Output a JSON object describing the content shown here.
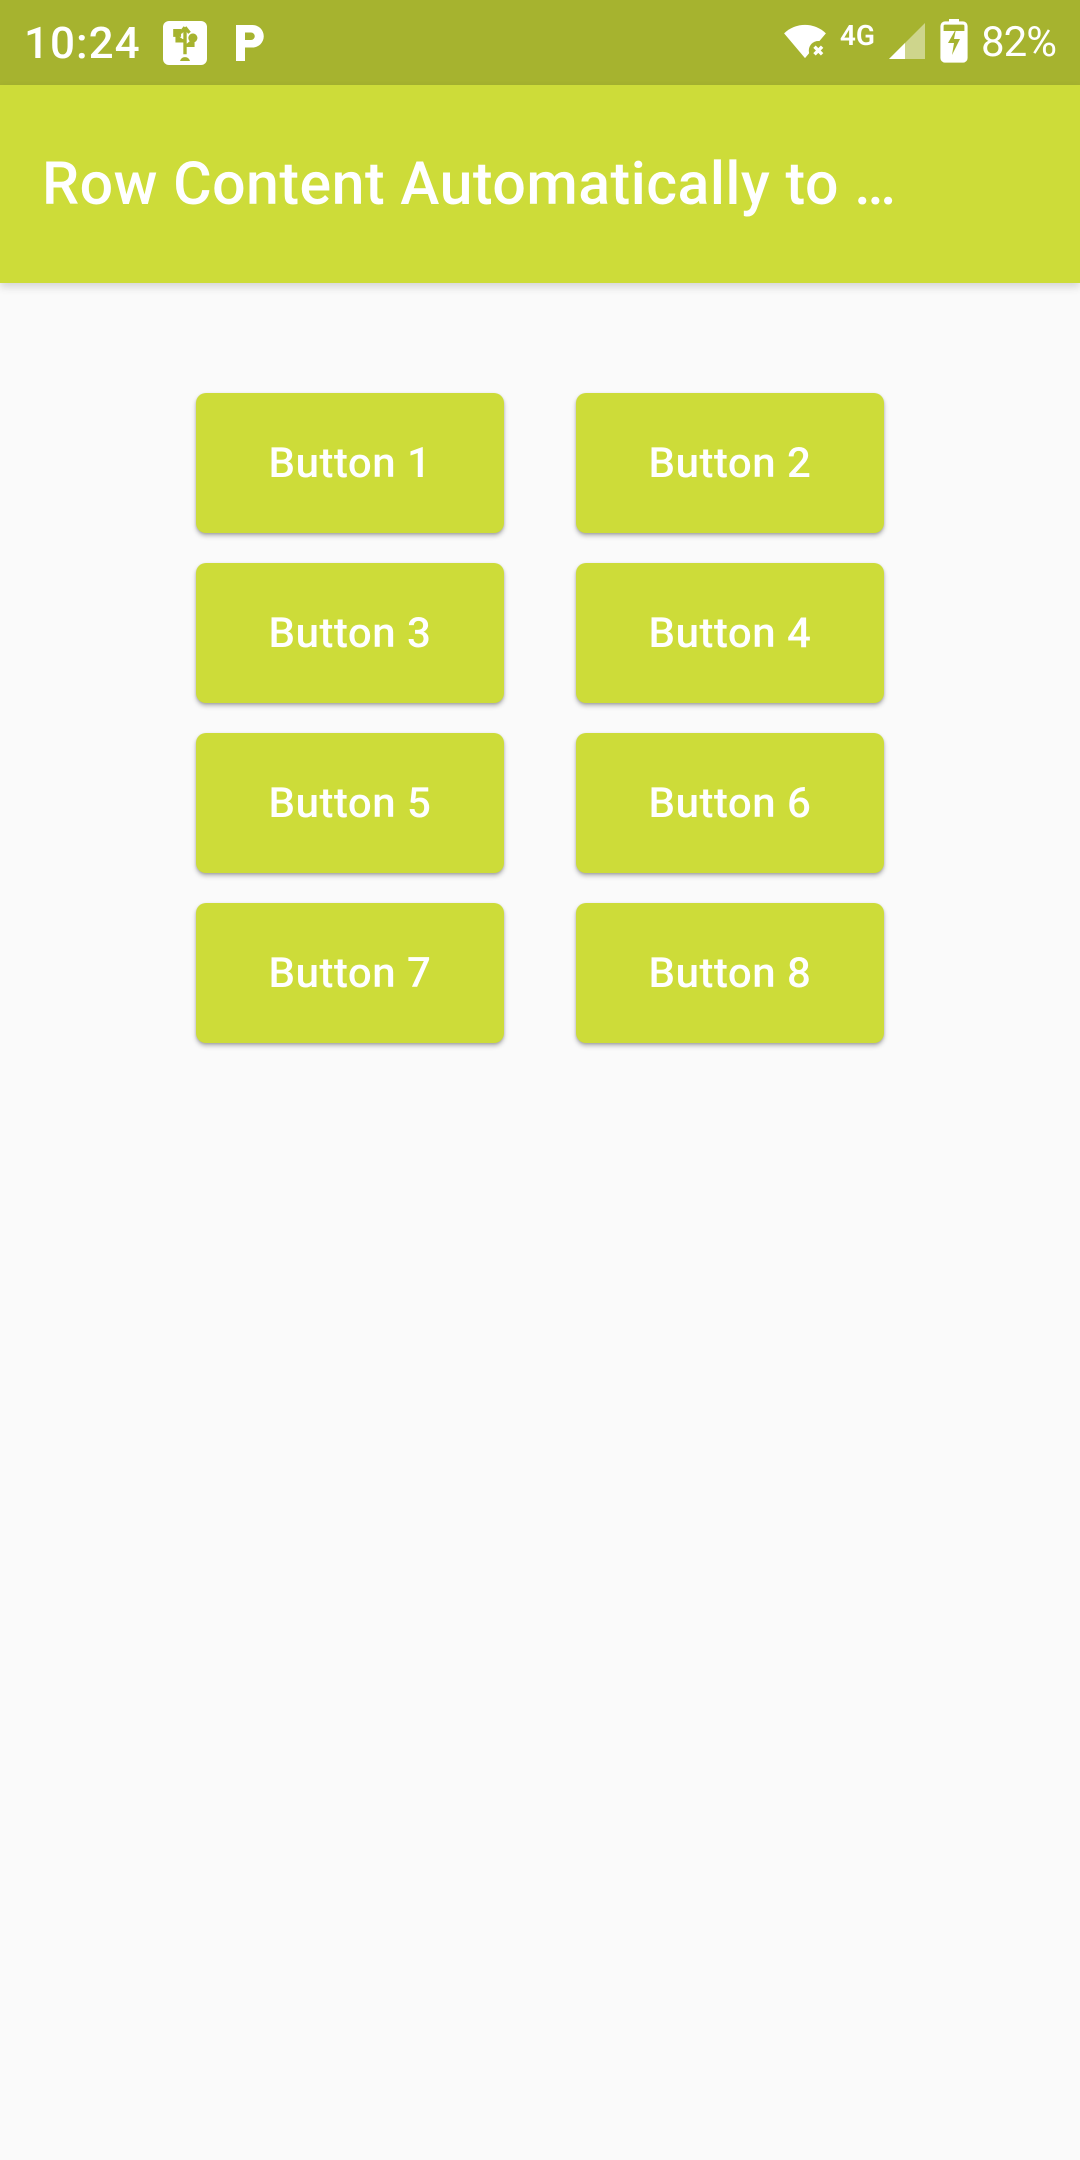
{
  "status_bar": {
    "time": "10:24",
    "battery": "82%",
    "network_label": "4G"
  },
  "app_bar": {
    "title": "Row Content Automatically to …"
  },
  "buttons": [
    {
      "label": "Button 1"
    },
    {
      "label": "Button 2"
    },
    {
      "label": "Button 3"
    },
    {
      "label": "Button 4"
    },
    {
      "label": "Button 5"
    },
    {
      "label": "Button 6"
    },
    {
      "label": "Button 7"
    },
    {
      "label": "Button 8"
    }
  ],
  "colors": {
    "status_bar_bg": "#a6b32f",
    "primary": "#cddc39",
    "page_bg": "#fafafa"
  }
}
